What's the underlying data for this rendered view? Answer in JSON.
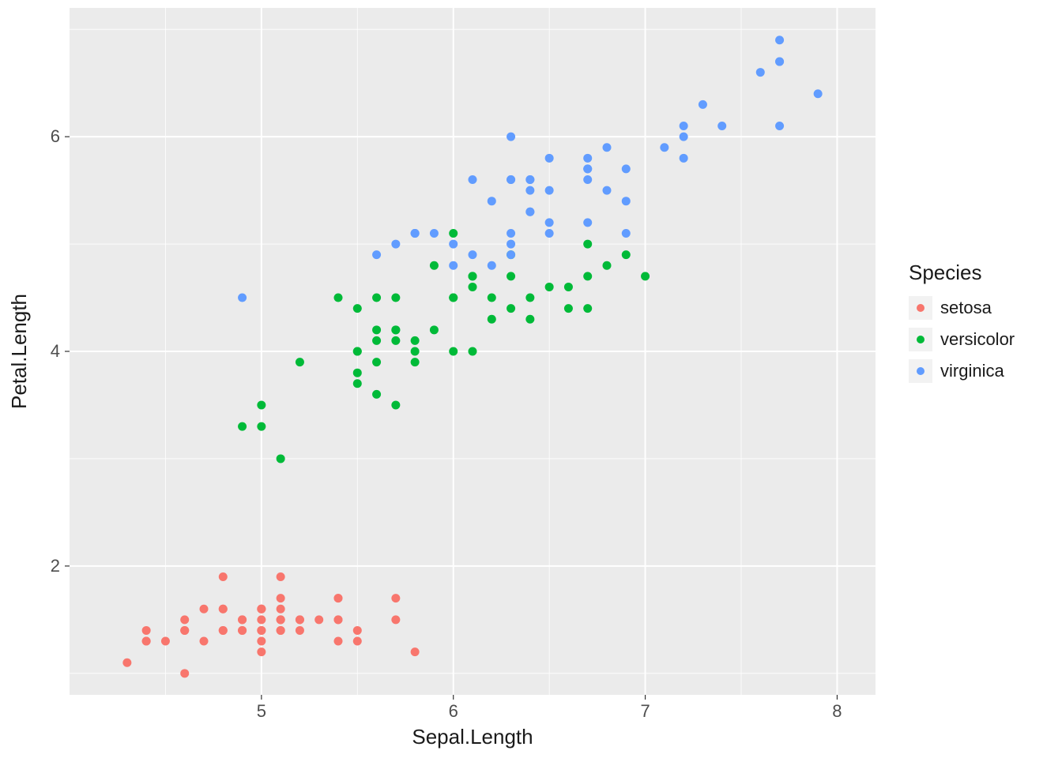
{
  "chart_data": {
    "type": "scatter",
    "xlabel": "Sepal.Length",
    "ylabel": "Petal.Length",
    "xlim": [
      4.0,
      8.2
    ],
    "ylim": [
      0.8,
      7.2
    ],
    "x_ticks": [
      5,
      6,
      7,
      8
    ],
    "y_ticks": [
      2,
      4,
      6
    ],
    "legend_title": "Species",
    "series": [
      {
        "name": "setosa",
        "color": "#F8766D",
        "points": [
          [
            5.1,
            1.4
          ],
          [
            4.9,
            1.4
          ],
          [
            4.7,
            1.3
          ],
          [
            4.6,
            1.5
          ],
          [
            5.0,
            1.4
          ],
          [
            5.4,
            1.7
          ],
          [
            4.6,
            1.4
          ],
          [
            5.0,
            1.5
          ],
          [
            4.4,
            1.4
          ],
          [
            4.9,
            1.5
          ],
          [
            5.4,
            1.5
          ],
          [
            4.8,
            1.6
          ],
          [
            4.8,
            1.4
          ],
          [
            4.3,
            1.1
          ],
          [
            5.8,
            1.2
          ],
          [
            5.7,
            1.5
          ],
          [
            5.4,
            1.3
          ],
          [
            5.1,
            1.4
          ],
          [
            5.7,
            1.7
          ],
          [
            5.1,
            1.5
          ],
          [
            5.4,
            1.7
          ],
          [
            5.1,
            1.5
          ],
          [
            4.6,
            1.0
          ],
          [
            5.1,
            1.7
          ],
          [
            4.8,
            1.9
          ],
          [
            5.0,
            1.6
          ],
          [
            5.0,
            1.6
          ],
          [
            5.2,
            1.5
          ],
          [
            5.2,
            1.4
          ],
          [
            4.7,
            1.6
          ],
          [
            4.8,
            1.6
          ],
          [
            5.4,
            1.5
          ],
          [
            5.2,
            1.5
          ],
          [
            5.5,
            1.4
          ],
          [
            4.9,
            1.5
          ],
          [
            5.0,
            1.2
          ],
          [
            5.5,
            1.3
          ],
          [
            4.9,
            1.4
          ],
          [
            4.4,
            1.3
          ],
          [
            5.1,
            1.5
          ],
          [
            5.0,
            1.3
          ],
          [
            4.5,
            1.3
          ],
          [
            4.4,
            1.3
          ],
          [
            5.0,
            1.6
          ],
          [
            5.1,
            1.9
          ],
          [
            4.8,
            1.4
          ],
          [
            5.1,
            1.6
          ],
          [
            4.6,
            1.4
          ],
          [
            5.3,
            1.5
          ],
          [
            5.0,
            1.4
          ]
        ]
      },
      {
        "name": "versicolor",
        "color": "#00BA38",
        "points": [
          [
            7.0,
            4.7
          ],
          [
            6.4,
            4.5
          ],
          [
            6.9,
            4.9
          ],
          [
            5.5,
            4.0
          ],
          [
            6.5,
            4.6
          ],
          [
            5.7,
            4.5
          ],
          [
            6.3,
            4.7
          ],
          [
            4.9,
            3.3
          ],
          [
            6.6,
            4.6
          ],
          [
            5.2,
            3.9
          ],
          [
            5.0,
            3.5
          ],
          [
            5.9,
            4.2
          ],
          [
            6.0,
            4.0
          ],
          [
            6.1,
            4.7
          ],
          [
            5.6,
            3.6
          ],
          [
            6.7,
            4.4
          ],
          [
            5.6,
            4.5
          ],
          [
            5.8,
            4.1
          ],
          [
            6.2,
            4.5
          ],
          [
            5.6,
            3.9
          ],
          [
            5.9,
            4.8
          ],
          [
            6.1,
            4.0
          ],
          [
            6.3,
            4.9
          ],
          [
            6.1,
            4.7
          ],
          [
            6.4,
            4.3
          ],
          [
            6.6,
            4.4
          ],
          [
            6.8,
            4.8
          ],
          [
            6.7,
            5.0
          ],
          [
            6.0,
            4.5
          ],
          [
            5.7,
            3.5
          ],
          [
            5.5,
            3.8
          ],
          [
            5.5,
            3.7
          ],
          [
            5.8,
            3.9
          ],
          [
            6.0,
            5.1
          ],
          [
            5.4,
            4.5
          ],
          [
            6.0,
            4.5
          ],
          [
            6.7,
            4.7
          ],
          [
            6.3,
            4.4
          ],
          [
            5.6,
            4.1
          ],
          [
            5.5,
            4.0
          ],
          [
            5.5,
            4.4
          ],
          [
            6.1,
            4.6
          ],
          [
            5.8,
            4.0
          ],
          [
            5.0,
            3.3
          ],
          [
            5.6,
            4.2
          ],
          [
            5.7,
            4.2
          ],
          [
            5.7,
            4.2
          ],
          [
            6.2,
            4.3
          ],
          [
            5.1,
            3.0
          ],
          [
            5.7,
            4.1
          ]
        ]
      },
      {
        "name": "virginica",
        "color": "#619CFF",
        "points": [
          [
            6.3,
            6.0
          ],
          [
            5.8,
            5.1
          ],
          [
            7.1,
            5.9
          ],
          [
            6.3,
            5.6
          ],
          [
            6.5,
            5.8
          ],
          [
            7.6,
            6.6
          ],
          [
            4.9,
            4.5
          ],
          [
            7.3,
            6.3
          ],
          [
            6.7,
            5.8
          ],
          [
            7.2,
            6.1
          ],
          [
            6.5,
            5.1
          ],
          [
            6.4,
            5.3
          ],
          [
            6.8,
            5.5
          ],
          [
            5.7,
            5.0
          ],
          [
            5.8,
            5.1
          ],
          [
            6.4,
            5.3
          ],
          [
            6.5,
            5.5
          ],
          [
            7.7,
            6.7
          ],
          [
            7.7,
            6.9
          ],
          [
            6.0,
            5.0
          ],
          [
            6.9,
            5.7
          ],
          [
            5.6,
            4.9
          ],
          [
            7.7,
            6.7
          ],
          [
            6.3,
            4.9
          ],
          [
            6.7,
            5.7
          ],
          [
            7.2,
            6.0
          ],
          [
            6.2,
            4.8
          ],
          [
            6.1,
            4.9
          ],
          [
            6.4,
            5.6
          ],
          [
            7.2,
            5.8
          ],
          [
            7.4,
            6.1
          ],
          [
            7.9,
            6.4
          ],
          [
            6.4,
            5.6
          ],
          [
            6.3,
            5.1
          ],
          [
            6.1,
            5.6
          ],
          [
            7.7,
            6.1
          ],
          [
            6.3,
            5.6
          ],
          [
            6.4,
            5.5
          ],
          [
            6.0,
            4.8
          ],
          [
            6.9,
            5.4
          ],
          [
            6.7,
            5.6
          ],
          [
            6.9,
            5.1
          ],
          [
            5.8,
            5.1
          ],
          [
            6.8,
            5.9
          ],
          [
            6.7,
            5.7
          ],
          [
            6.7,
            5.2
          ],
          [
            6.3,
            5.0
          ],
          [
            6.5,
            5.2
          ],
          [
            6.2,
            5.4
          ],
          [
            5.9,
            5.1
          ]
        ]
      }
    ]
  }
}
